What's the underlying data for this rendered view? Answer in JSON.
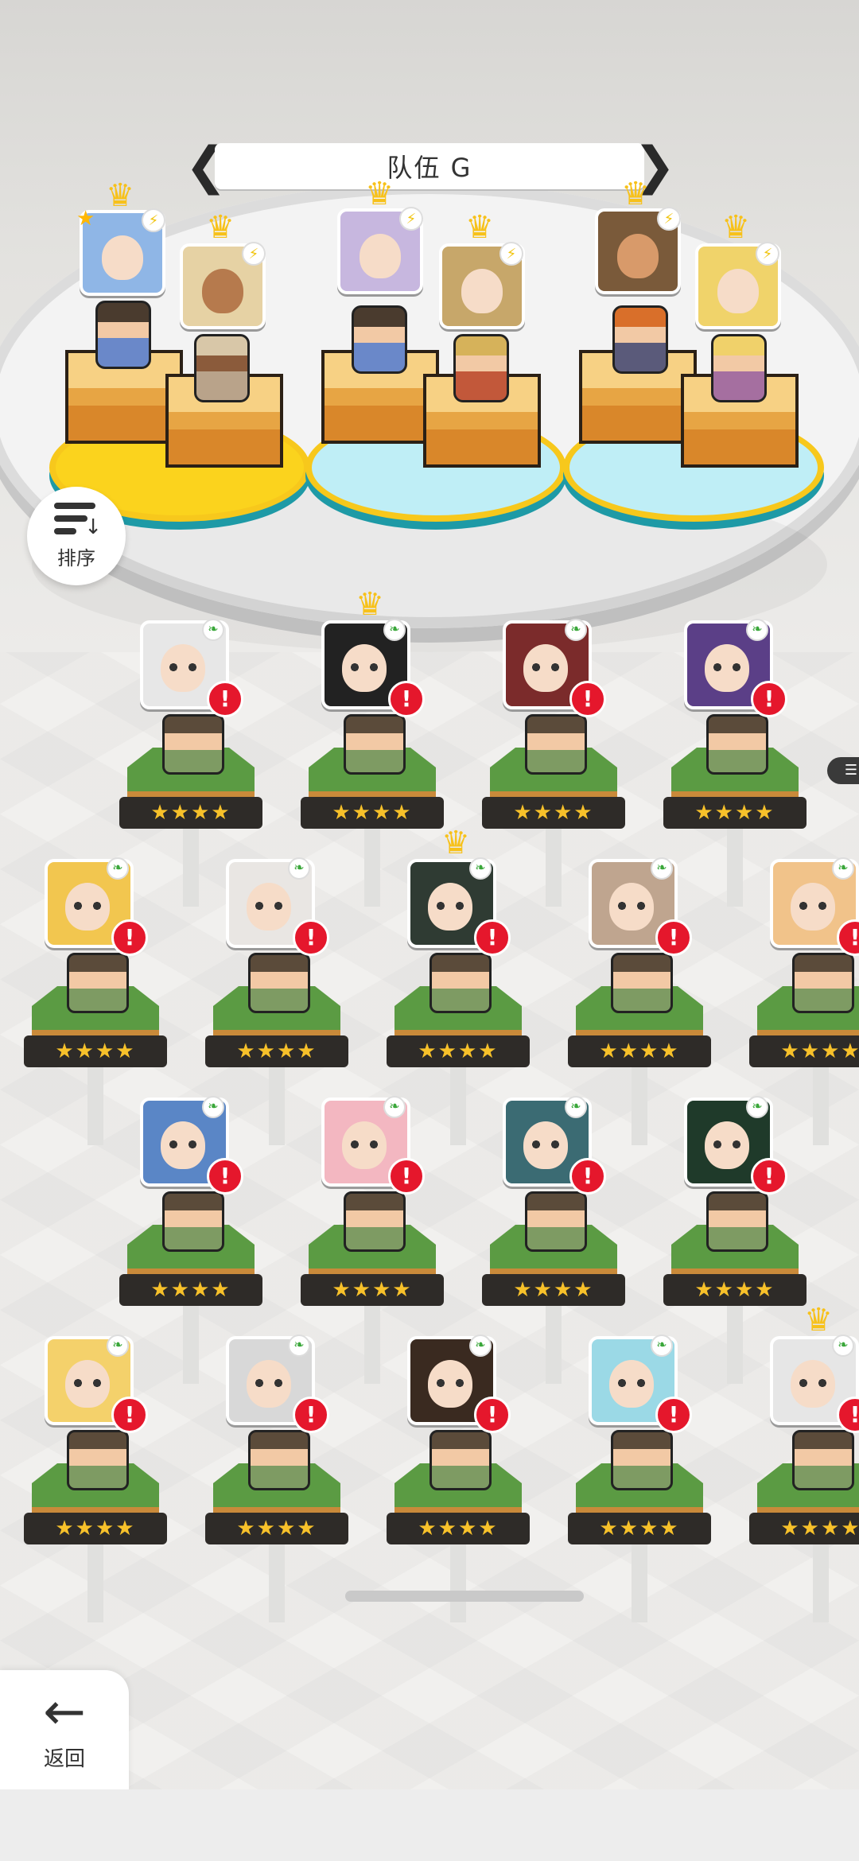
{
  "team": {
    "title": "队伍 G",
    "prev_icon": "chevron-left-icon",
    "next_icon": "chevron-right-icon"
  },
  "sort": {
    "label": "排序",
    "icon": "sort-icon"
  },
  "back": {
    "label": "返回",
    "icon": "arrow-left-icon"
  },
  "rows": [
    [
      {
        "stars": "★★★★",
        "crown": false,
        "alert": true,
        "hair": "#e7e7e7"
      },
      {
        "stars": "★★★★",
        "crown": true,
        "alert": true,
        "hair": "#222222"
      },
      {
        "stars": "★★★★",
        "crown": false,
        "alert": true,
        "hair": "#7b2b2b"
      },
      {
        "stars": "★★★★",
        "crown": false,
        "alert": true,
        "hair": "#5b3f87"
      }
    ],
    [
      {
        "stars": "★★★★",
        "crown": false,
        "alert": true,
        "hair": "#f2c64f"
      },
      {
        "stars": "★★★★",
        "crown": false,
        "alert": true,
        "hair": "#e9e6e3"
      },
      {
        "stars": "★★★★",
        "crown": true,
        "alert": true,
        "hair": "#2f3b33"
      },
      {
        "stars": "★★★★",
        "crown": false,
        "alert": true,
        "hair": "#bfa58f"
      },
      {
        "stars": "★★★★",
        "crown": false,
        "alert": true,
        "hair": "#f1c38a"
      }
    ],
    [
      {
        "stars": "★★★★",
        "crown": false,
        "alert": true,
        "hair": "#5a86c6"
      },
      {
        "stars": "★★★★",
        "crown": false,
        "alert": true,
        "hair": "#f3b7c1"
      },
      {
        "stars": "★★★★",
        "crown": false,
        "alert": true,
        "hair": "#3b6b73"
      },
      {
        "stars": "★★★★",
        "crown": false,
        "alert": true,
        "hair": "#1f3a2a"
      }
    ],
    [
      {
        "stars": "★★★★",
        "crown": false,
        "alert": true,
        "hair": "#f4d16b"
      },
      {
        "stars": "★★★★",
        "crown": false,
        "alert": true,
        "hair": "#d8d8d8"
      },
      {
        "stars": "★★★★",
        "crown": false,
        "alert": true,
        "hair": "#3a2a20"
      },
      {
        "stars": "★★★★",
        "crown": false,
        "alert": true,
        "hair": "#9bd9e6"
      },
      {
        "stars": "★★★★",
        "crown": true,
        "alert": true,
        "hair": "#e6e6e6"
      }
    ]
  ],
  "colors": {
    "alert": "#e5172c",
    "crown": "#f7c11a",
    "stars": "#f7c12a"
  }
}
